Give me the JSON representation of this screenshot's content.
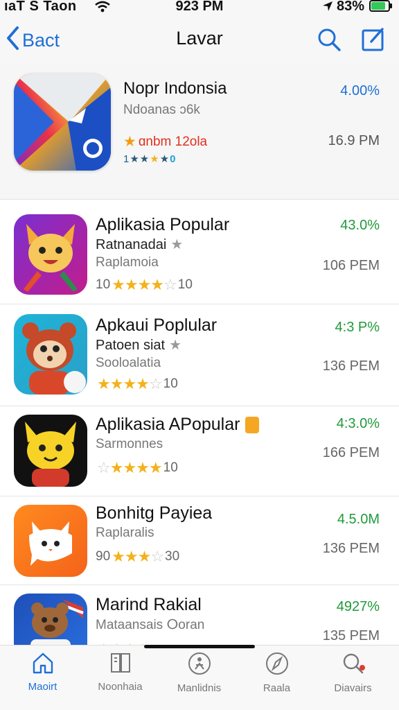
{
  "status_bar": {
    "carrier": "ıaT S Taon",
    "time": "923 PM",
    "battery": "83%",
    "icons": [
      "wifi-icon",
      "location-icon",
      "battery-icon"
    ],
    "battery_color": "#34c759"
  },
  "nav": {
    "back_label": "Bact",
    "title": "Lavar",
    "icons": [
      "chevron-left-icon",
      "search-icon",
      "compose-icon"
    ],
    "accent": "#1f6fd6"
  },
  "featured": {
    "title": "Nopr Indonsia",
    "subtitle": "Ndoanas ɔ6k",
    "badge": "ɑnbm 12ola",
    "rating_text": "1",
    "rating_tail": "0",
    "percent": "4.00%",
    "time": "16.9 PM"
  },
  "apps": [
    {
      "title": "Aplikasia Popular",
      "sub1": "Ratnanadai",
      "sub2": "Raplamoia",
      "rating_prefix": "10",
      "rating_suffix": "10",
      "percent": "43.0%",
      "time": "106 PEM",
      "icon": "fox-icon"
    },
    {
      "title": "Apkaui Poplular",
      "sub1": "Patoen siat",
      "sub2": "Sooloalatia",
      "rating_prefix": "",
      "rating_suffix": "10",
      "percent": "4:3 P%",
      "time": "136 PEM",
      "icon": "bear-icon"
    },
    {
      "title": "Aplikasia APopular",
      "sub1": "Sarmonnes",
      "sub2": "",
      "rating_prefix": "",
      "rating_suffix": "10",
      "percent": "4:3.0%",
      "time": "166 PEM",
      "icon": "cat-icon"
    },
    {
      "title": "Bonhitg Payiea",
      "sub1": "Raplaralis",
      "sub2": "",
      "rating_prefix": "90",
      "rating_suffix": "30",
      "percent": "4.5.0M",
      "time": "136 PEM",
      "icon": "white-cat-icon"
    },
    {
      "title": "Marind Rakial",
      "sub1": "Mataansais ⵔoran",
      "sub2": "",
      "rating_prefix": "",
      "rating_suffix": "",
      "percent": "4927%",
      "time": "135 PEM",
      "icon": "bear-suit-icon"
    }
  ],
  "tabs": [
    {
      "label": "Maoirt",
      "icon": "home-icon"
    },
    {
      "label": "Noonhaia",
      "icon": "book-icon"
    },
    {
      "label": "Manlidnis",
      "icon": "games-icon"
    },
    {
      "label": "Raala",
      "icon": "compass-icon"
    },
    {
      "label": "Diavairs",
      "icon": "search-icon"
    }
  ]
}
